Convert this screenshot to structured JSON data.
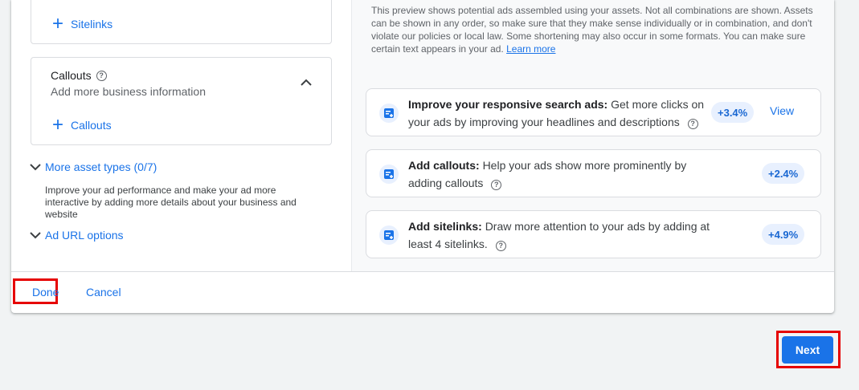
{
  "left": {
    "sitelinks": {
      "add_label": "Sitelinks"
    },
    "callouts": {
      "title": "Callouts",
      "subtitle": "Add more business information",
      "add_label": "Callouts"
    },
    "more_asset_types": {
      "label": "More asset types (0/7)",
      "description": "Improve your ad performance and make your ad more interactive by adding more details about your business and website"
    },
    "ad_url_options": {
      "label": "Ad URL options"
    }
  },
  "preview": {
    "notice": "This preview shows potential ads assembled using your assets. Not all combinations are shown. Assets can be shown in any order, so make sure that they make sense individually or in combination, and don't violate our policies or local law. Some shortening may also occur in some formats. You can make sure certain text appears in your ad.",
    "learn_more": "Learn more"
  },
  "recommendations": [
    {
      "title": "Improve your responsive search ads:",
      "text": "Get more clicks on your ads by improving your headlines and descriptions",
      "uplift": "+3.4%",
      "action": "View"
    },
    {
      "title": "Add callouts:",
      "text": "Help your ads show more prominently by adding callouts",
      "uplift": "+2.4%"
    },
    {
      "title": "Add sitelinks:",
      "text": "Draw more attention to your ads by adding at least 4 sitelinks.",
      "uplift": "+4.9%"
    }
  ],
  "footer": {
    "done": "Done",
    "cancel": "Cancel"
  },
  "next": "Next",
  "colors": {
    "accent": "#1a73e8",
    "highlight": "#e60000",
    "chip_bg": "#e8f0fe"
  },
  "icons": [
    "plus-icon",
    "help-icon",
    "chevron-up-icon",
    "chevron-down-icon",
    "recommendation-icon"
  ]
}
